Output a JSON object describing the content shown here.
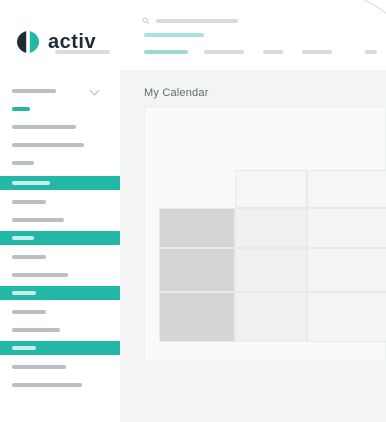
{
  "app": {
    "brand": "activ"
  },
  "page": {
    "title": "My Calendar"
  },
  "colors": {
    "accent": "#22b7a6",
    "sidebar_bg": "#ffffff",
    "main_bg": "#f3f4f4"
  },
  "icons": {
    "logo": "activ-logo-icon",
    "search": "search-icon",
    "chevron": "chevron-down-icon"
  },
  "sidebar": {
    "items": [
      {
        "type": "menu",
        "label": ""
      },
      {
        "type": "active",
        "label": ""
      },
      {
        "type": "menu",
        "label": ""
      },
      {
        "type": "menu",
        "label": ""
      },
      {
        "type": "menu",
        "label": ""
      },
      {
        "type": "group",
        "label": ""
      },
      {
        "type": "menu",
        "label": ""
      },
      {
        "type": "menu",
        "label": ""
      },
      {
        "type": "group",
        "label": ""
      },
      {
        "type": "menu",
        "label": ""
      },
      {
        "type": "menu",
        "label": ""
      },
      {
        "type": "group",
        "label": ""
      },
      {
        "type": "menu",
        "label": ""
      },
      {
        "type": "menu",
        "label": ""
      },
      {
        "type": "group",
        "label": ""
      },
      {
        "type": "menu",
        "label": ""
      },
      {
        "type": "menu",
        "label": ""
      }
    ]
  },
  "header": {
    "search_placeholder": "",
    "breadcrumb": "",
    "tabs": [
      {
        "label": "",
        "active": true
      },
      {
        "label": "",
        "active": false
      },
      {
        "label": "",
        "active": false
      },
      {
        "label": "",
        "active": false
      },
      {
        "label": "",
        "active": false
      }
    ]
  },
  "calendar": {
    "legend": [
      {
        "label": ""
      },
      {
        "label": ""
      },
      {
        "label": ""
      },
      {
        "label": ""
      }
    ]
  }
}
